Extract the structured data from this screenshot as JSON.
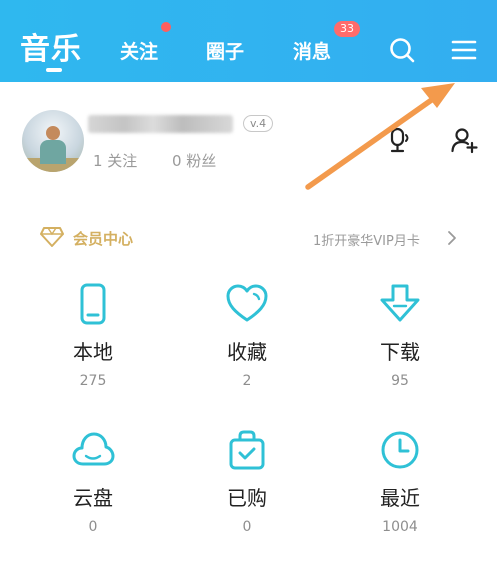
{
  "header": {
    "title": "音乐",
    "tabs": [
      {
        "label": "关注"
      },
      {
        "label": "圈子"
      },
      {
        "label": "消息",
        "badge": "33"
      }
    ],
    "icons": [
      "search-icon",
      "menu-icon"
    ]
  },
  "profile": {
    "level": "v.4",
    "follow": "1 关注",
    "fans": "0 粉丝"
  },
  "vip": {
    "label": "会员中心",
    "promo": "1折开豪华VIP月卡"
  },
  "grid": [
    {
      "label": "本地",
      "count": "275",
      "icon": "phone-icon"
    },
    {
      "label": "收藏",
      "count": "2",
      "icon": "heart-icon"
    },
    {
      "label": "下载",
      "count": "95",
      "icon": "download-icon"
    },
    {
      "label": "云盘",
      "count": "0",
      "icon": "cloud-icon"
    },
    {
      "label": "已购",
      "count": "0",
      "icon": "shopping-bag-icon"
    },
    {
      "label": "最近",
      "count": "1004",
      "icon": "clock-icon"
    }
  ],
  "colors": {
    "header": "#33b2ef",
    "accent": "#2fc1d6",
    "vip": "#d4b061",
    "annotation_arrow": "#f39a4c"
  }
}
